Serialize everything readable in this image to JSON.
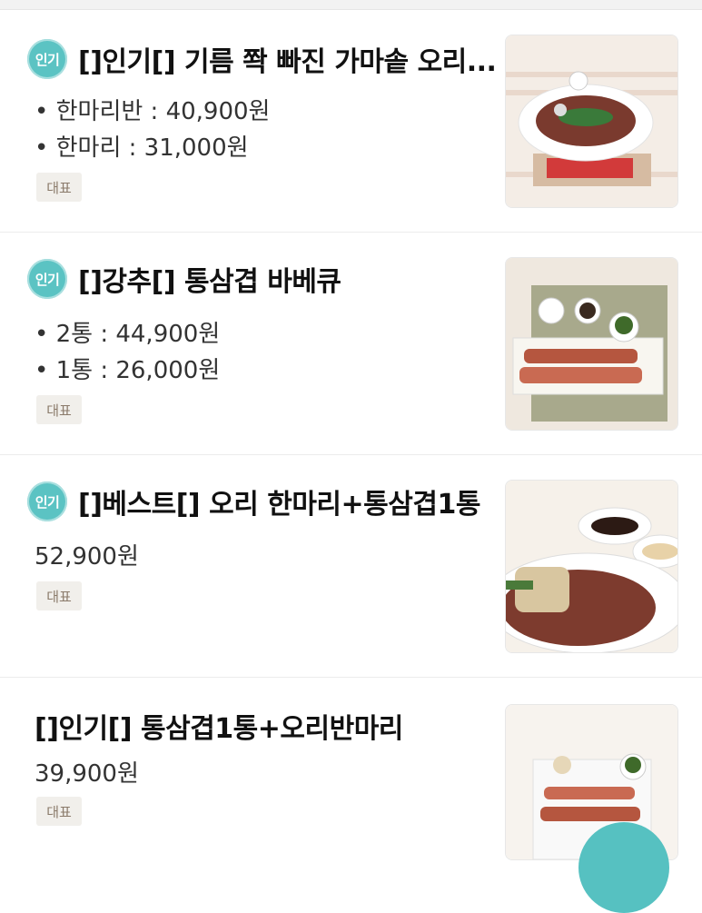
{
  "items": [
    {
      "badge": "인기",
      "title": "[]인기[] 기름 쫙 빠진 가마솥 오리...",
      "prices": [
        "• 한마리반 : 40,900원",
        "• 한마리 : 31,000원"
      ],
      "tag": "대표"
    },
    {
      "badge": "인기",
      "title": "[]강추[] 통삼겹 바베큐",
      "prices": [
        "• 2통 : 44,900원",
        "• 1통 : 26,000원"
      ],
      "tag": "대표"
    },
    {
      "badge": "인기",
      "title": "[]베스트[] 오리 한마리+통삼겹1통",
      "prices": [
        "52,900원"
      ],
      "tag": "대표"
    },
    {
      "badge": "",
      "title": "[]인기[] 통삼겹1통+오리반마리",
      "prices": [
        "39,900원"
      ],
      "tag": "대표"
    }
  ],
  "colors": {
    "accent": "#5bc3c3",
    "tag_bg": "#f1efeb",
    "tag_text": "#8a7a6a"
  }
}
